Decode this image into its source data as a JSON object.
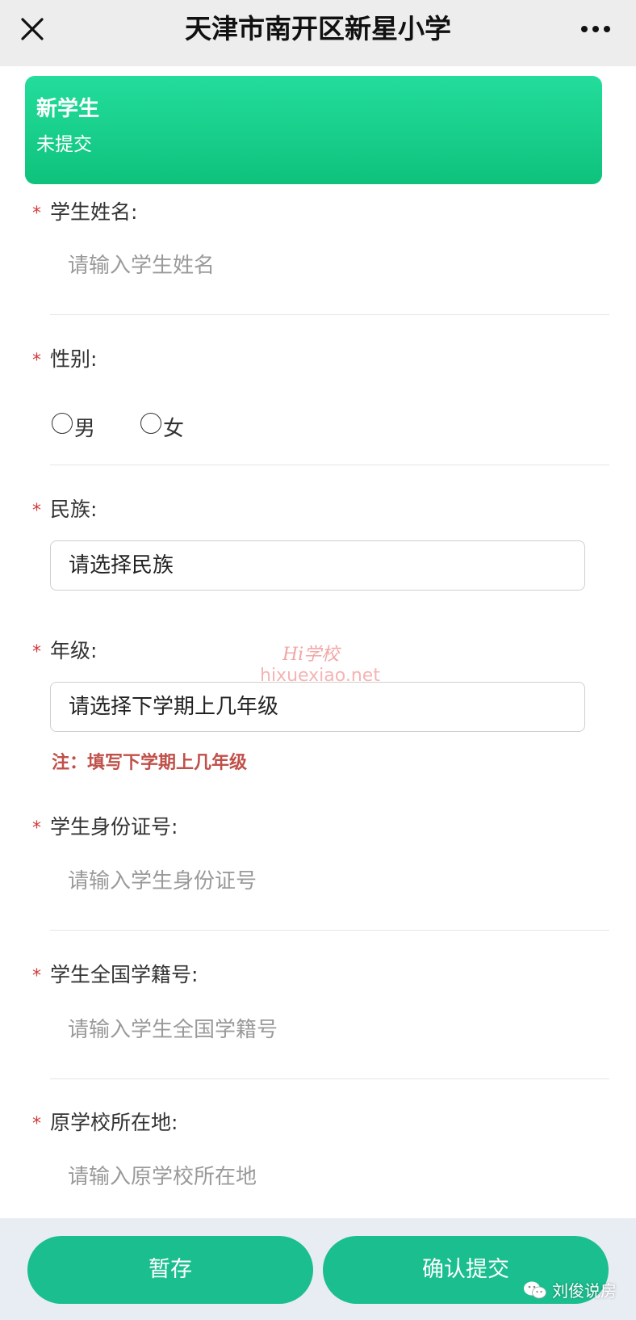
{
  "header": {
    "title": "天津市南开区新星小学"
  },
  "banner": {
    "title": "新学生",
    "status": "未提交"
  },
  "form": {
    "required_mark": "*",
    "name": {
      "label": "学生姓名:",
      "placeholder": "请输入学生姓名"
    },
    "gender": {
      "label": "性别:",
      "options": [
        "男",
        "女"
      ]
    },
    "ethnicity": {
      "label": "民族:",
      "select_text": "请选择民族"
    },
    "grade": {
      "label": "年级:",
      "select_text": "请选择下学期上几年级",
      "note": "注：填写下学期上几年级"
    },
    "id_number": {
      "label": "学生身份证号:",
      "placeholder": "请输入学生身份证号"
    },
    "student_no": {
      "label": "学生全国学籍号:",
      "placeholder": "请输入学生全国学籍号"
    },
    "prev_school": {
      "label": "原学校所在地:",
      "placeholder": "请输入原学校所在地"
    }
  },
  "watermark": {
    "line1": "Hi学校",
    "line2": "hixuexiao.net"
  },
  "actions": {
    "save": "暂存",
    "submit": "确认提交"
  },
  "footer_mark": {
    "text": "刘俊说房"
  },
  "colors": {
    "accent": "#1bbe8f",
    "banner_top": "#24dd9c",
    "banner_bottom": "#0ec27c",
    "required": "#d23b3b",
    "note": "#c0504a"
  }
}
